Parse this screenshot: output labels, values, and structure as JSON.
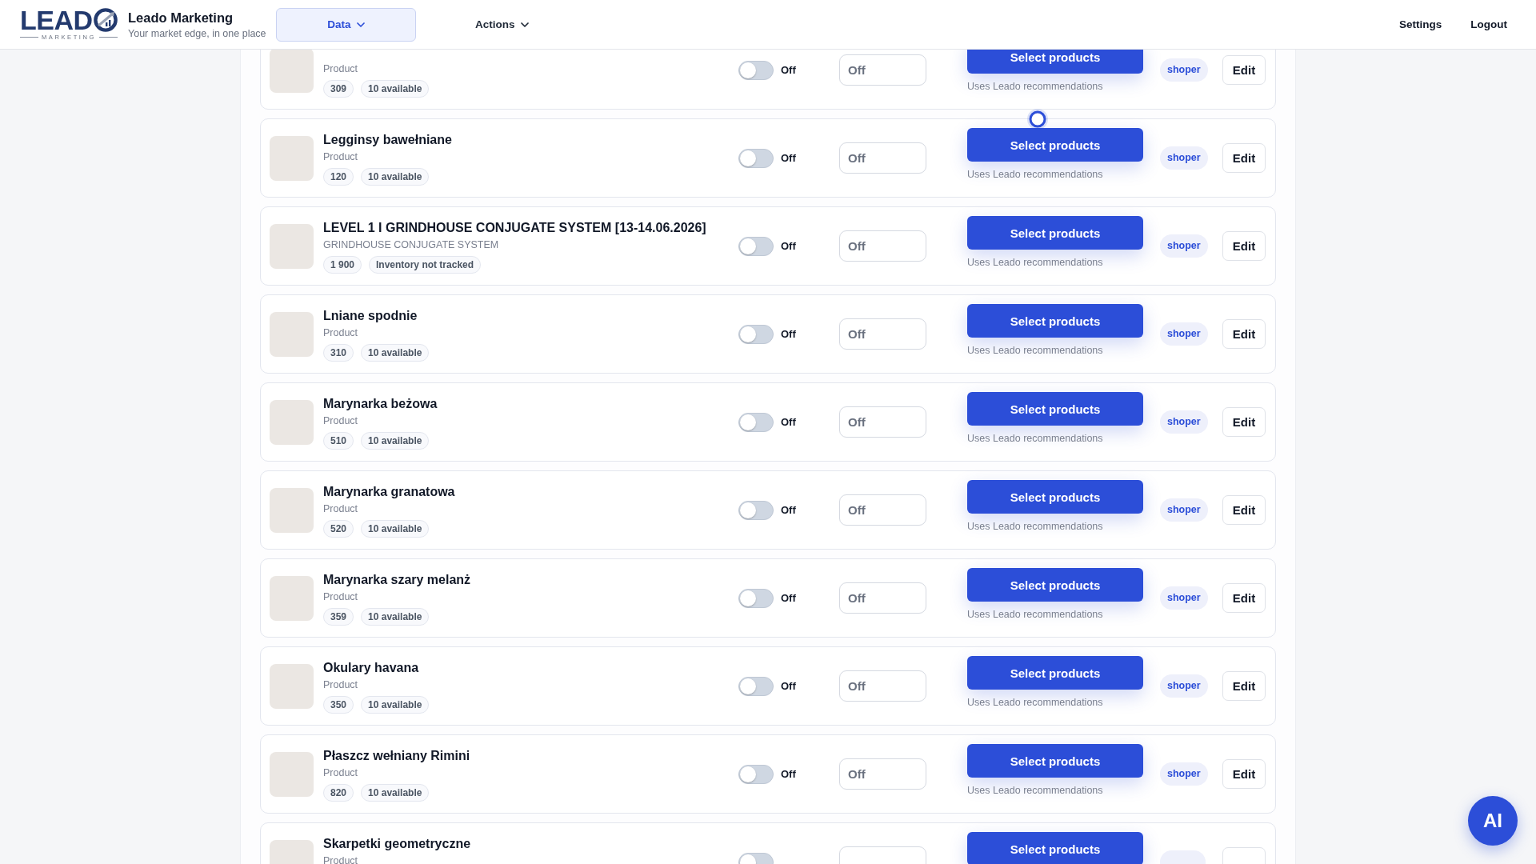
{
  "header": {
    "logo": {
      "wordmark": "LEAD",
      "tagline": "MARKETING"
    },
    "brand": {
      "name": "Leado Marketing",
      "subtitle": "Your market edge, in one place"
    },
    "nav": [
      {
        "label": "Data",
        "selected": true,
        "dropdown": true
      },
      {
        "label": "Actions",
        "selected": false,
        "dropdown": true
      }
    ],
    "links": [
      "Settings",
      "Logout"
    ]
  },
  "products": [
    {
      "subtitle": "Product",
      "tags": [
        "309",
        "10 available"
      ],
      "enabled": false,
      "toggle_label": "Off",
      "field_value": "Off",
      "button": "Select products",
      "hint": "Uses Leado recommendations",
      "badge": "shoper",
      "action": "Edit"
    },
    {
      "name": "Legginsy bawełniane",
      "subtitle": "Product",
      "tags": [
        "120",
        "10 available"
      ],
      "enabled": false,
      "toggle_label": "Off",
      "field_value": "Off",
      "button": "Select products",
      "hint": "Uses Leado recommendations",
      "badge": "shoper",
      "action": "Edit"
    },
    {
      "name": "LEVEL 1 I GRINDHOUSE CONJUGATE SYSTEM [13-14.06.2026]",
      "subtitle": "GRINDHOUSE CONJUGATE SYSTEM",
      "tags": [
        "1 900",
        "Inventory not tracked"
      ],
      "enabled": false,
      "toggle_label": "Off",
      "field_value": "Off",
      "button": "Select products",
      "hint": "Uses Leado recommendations",
      "badge": "shoper",
      "action": "Edit"
    },
    {
      "name": "Lniane spodnie",
      "subtitle": "Product",
      "tags": [
        "310",
        "10 available"
      ],
      "enabled": false,
      "toggle_label": "Off",
      "field_value": "Off",
      "button": "Select products",
      "hint": "Uses Leado recommendations",
      "badge": "shoper",
      "action": "Edit"
    },
    {
      "name": "Marynarka beżowa",
      "subtitle": "Product",
      "tags": [
        "510",
        "10 available"
      ],
      "enabled": false,
      "toggle_label": "Off",
      "field_value": "Off",
      "button": "Select products",
      "hint": "Uses Leado recommendations",
      "badge": "shoper",
      "action": "Edit"
    },
    {
      "name": "Marynarka granatowa",
      "subtitle": "Product",
      "tags": [
        "520",
        "10 available"
      ],
      "enabled": false,
      "toggle_label": "Off",
      "field_value": "Off",
      "button": "Select products",
      "hint": "Uses Leado recommendations",
      "badge": "shoper",
      "action": "Edit"
    },
    {
      "name": "Marynarka szary melanż",
      "subtitle": "Product",
      "tags": [
        "359",
        "10 available"
      ],
      "enabled": false,
      "toggle_label": "Off",
      "field_value": "Off",
      "button": "Select products",
      "hint": "Uses Leado recommendations",
      "badge": "shoper",
      "action": "Edit"
    },
    {
      "name": "Okulary havana",
      "subtitle": "Product",
      "tags": [
        "350",
        "10 available"
      ],
      "enabled": false,
      "toggle_label": "Off",
      "field_value": "Off",
      "button": "Select products",
      "hint": "Uses Leado recommendations",
      "badge": "shoper",
      "action": "Edit"
    },
    {
      "name": "Płaszcz wełniany Rimini",
      "subtitle": "Product",
      "tags": [
        "820",
        "10 available"
      ],
      "enabled": false,
      "toggle_label": "Off",
      "field_value": "Off",
      "button": "Select products",
      "hint": "Uses Leado recommendations",
      "badge": "shoper",
      "action": "Edit"
    },
    {
      "name": "Skarpetki geometryczne",
      "subtitle": "Product",
      "enabled": false,
      "button": "Select products"
    }
  ],
  "assistant_button": {
    "label": "AI"
  }
}
